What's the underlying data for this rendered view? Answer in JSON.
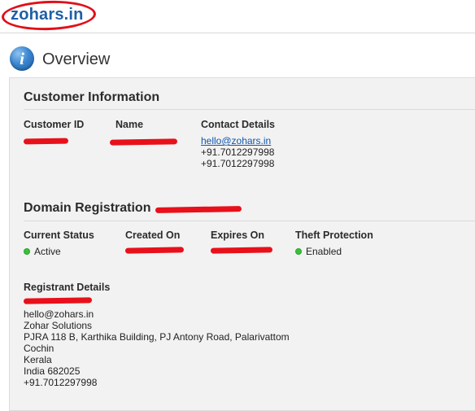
{
  "header": {
    "logo_text": "zohars.in"
  },
  "overview": {
    "title": "Overview",
    "icon": "info-icon"
  },
  "customer_info": {
    "heading": "Customer Information",
    "customer_id_label": "Customer ID",
    "name_label": "Name",
    "contact_label": "Contact Details",
    "contact_email": "hello@zohars.in",
    "contact_phone_1": "+91.7012297998",
    "contact_phone_2": "+91.7012297998"
  },
  "domain_registration": {
    "heading": "Domain Registration",
    "current_status_label": "Current Status",
    "current_status_value": "Active",
    "created_on_label": "Created On",
    "expires_on_label": "Expires On",
    "theft_protection_label": "Theft Protection",
    "theft_protection_value": "Enabled",
    "status_color": "#37c23a"
  },
  "registrant": {
    "label": "Registrant Details",
    "email": "hello@zohars.in",
    "company": "Zohar Solutions",
    "address": "PJRA 118 B, Karthika Building, PJ Antony Road, Palarivattom",
    "city": "Cochin",
    "state": "Kerala",
    "country_zip": "India 682025",
    "phone": "+91.7012297998"
  },
  "colors": {
    "redaction": "#e8101a",
    "logo": "#1f5fa6",
    "link": "#1155aa"
  }
}
